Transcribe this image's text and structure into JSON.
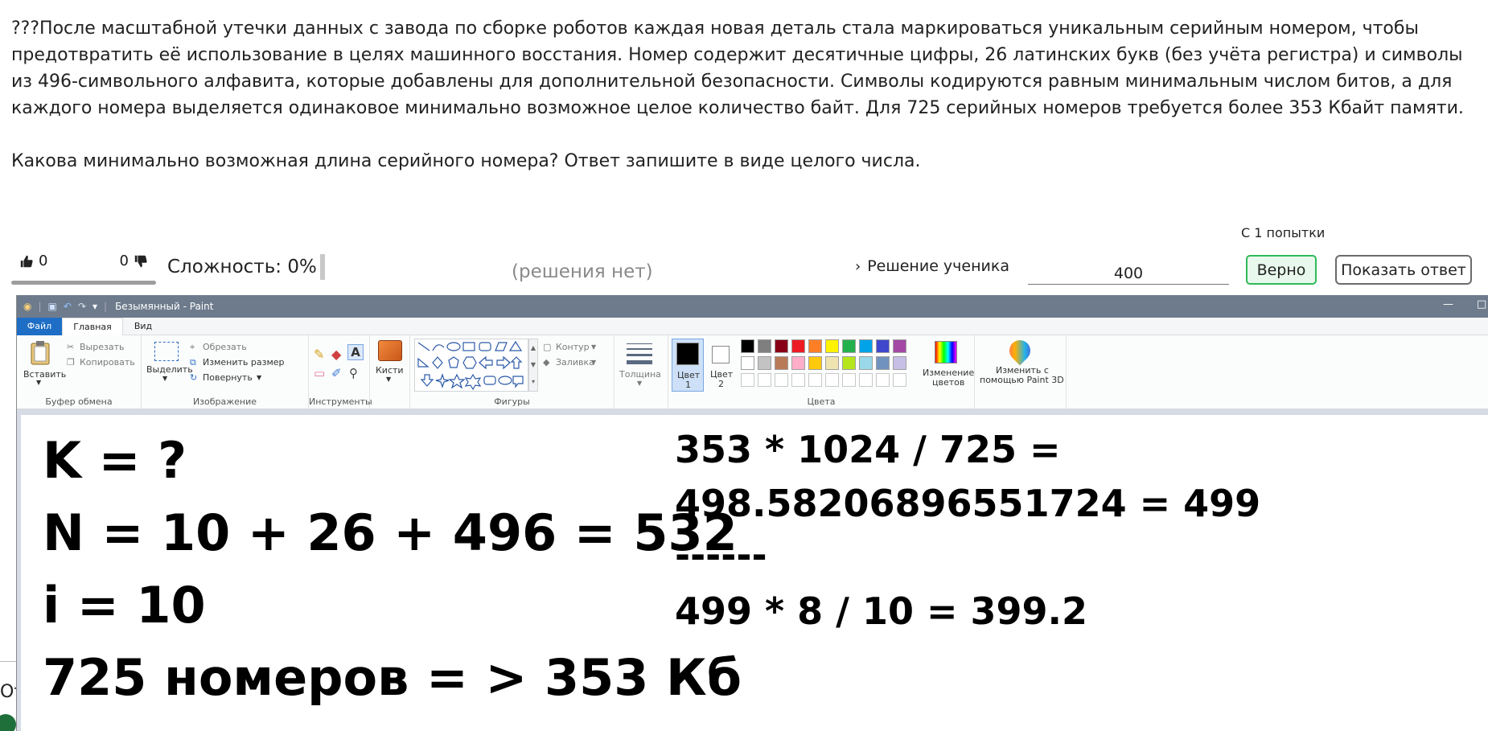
{
  "task": {
    "text": "???После масштабной утечки данных с завода по сборке роботов каждая новая деталь стала маркироваться уникальным серийным номером, чтобы предотвратить её использование в целях машинного восстания. Номер содержит десятичные цифры, 26 латинских букв (без учёта регистра) и символы из 496-символьного алфавита, которые добавлены для дополнительной безопасности. Символы кодируются равным минимальным числом битов, а для каждого номера выделяется одинаковое минимально возможное целое количество байт. Для 725 серийных номеров требуется более 353 Кбайт памяти.",
    "question": "Какова минимально возможная длина серийного номера? Ответ запишите в виде целого числа."
  },
  "meta": {
    "attempts": "С 1 попытки",
    "likes": "0",
    "dislikes": "0",
    "difficulty": "Сложность: 0%",
    "no_solutions": "(решения нет)",
    "student_solution": "Решение ученика",
    "answer_value": "400",
    "correct_label": "Верно",
    "show_answer_label": "Показать ответ",
    "peek_text": "От"
  },
  "paint": {
    "title": "Безымянный - Paint",
    "tabs": {
      "file": "Файл",
      "home": "Главная",
      "view": "Вид"
    },
    "clipboard": {
      "paste": "Вставить",
      "cut": "Вырезать",
      "copy": "Копировать",
      "label": "Буфер обмена"
    },
    "image": {
      "select": "Выделить",
      "crop": "Обрезать",
      "resize": "Изменить размер",
      "rotate": "Повернуть",
      "label": "Изображение"
    },
    "tools": {
      "label": "Инструменты"
    },
    "brushes": {
      "label": "Кисти"
    },
    "shapes": {
      "outline": "Контур",
      "fill": "Заливка",
      "label": "Фигуры"
    },
    "size": {
      "label": "Толщина"
    },
    "colors": {
      "color1_line1": "Цвет",
      "color1_line2": "1",
      "color2_line1": "Цвет",
      "color2_line2": "2",
      "edit_line1": "Изменение",
      "edit_line2": "цветов",
      "label": "Цвета",
      "row1": [
        "#000000",
        "#7f7f7f",
        "#880015",
        "#ed1c24",
        "#ff7f27",
        "#fff200",
        "#22b14c",
        "#00a2e8",
        "#3f48cc",
        "#a349a4"
      ],
      "row2": [
        "#ffffff",
        "#c3c3c3",
        "#b97a57",
        "#ffaec9",
        "#ffc90e",
        "#efe4b0",
        "#b5e61d",
        "#99d9ea",
        "#7092be",
        "#c8bfe7"
      ]
    },
    "paint3d": {
      "line1": "Изменить с",
      "line2": "помощью Paint 3D"
    },
    "canvas": {
      "left": [
        "K = ?",
        "N = 10 + 26 + 496 = 532",
        "i = 10",
        "725 номеров =  > 353 Кб"
      ],
      "right": [
        "353 * 1024 / 725 =",
        "498.58206896551724 = 499",
        "------",
        "499 * 8 / 10 = 399.2"
      ]
    }
  }
}
